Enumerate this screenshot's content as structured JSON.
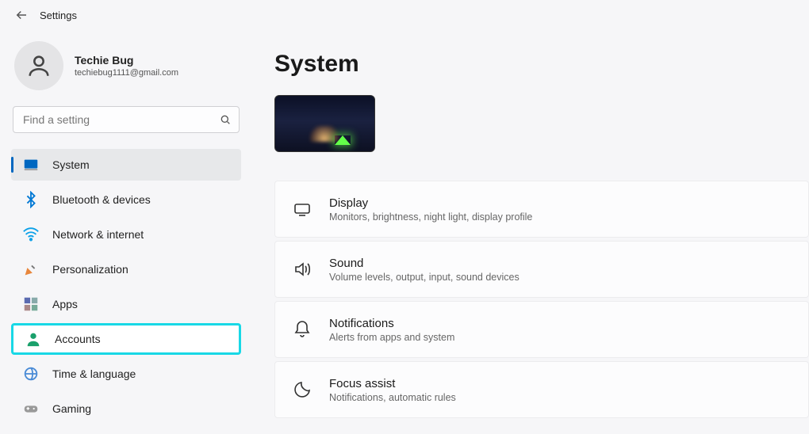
{
  "app": {
    "title": "Settings"
  },
  "user": {
    "name": "Techie Bug",
    "email": "techiebug1111@gmail.com"
  },
  "search": {
    "placeholder": "Find a setting"
  },
  "sidebar": {
    "items": [
      {
        "label": "System"
      },
      {
        "label": "Bluetooth & devices"
      },
      {
        "label": "Network & internet"
      },
      {
        "label": "Personalization"
      },
      {
        "label": "Apps"
      },
      {
        "label": "Accounts"
      },
      {
        "label": "Time & language"
      },
      {
        "label": "Gaming"
      }
    ]
  },
  "main": {
    "title": "System",
    "rows": [
      {
        "title": "Display",
        "subtitle": "Monitors, brightness, night light, display profile"
      },
      {
        "title": "Sound",
        "subtitle": "Volume levels, output, input, sound devices"
      },
      {
        "title": "Notifications",
        "subtitle": "Alerts from apps and system"
      },
      {
        "title": "Focus assist",
        "subtitle": "Notifications, automatic rules"
      }
    ]
  }
}
